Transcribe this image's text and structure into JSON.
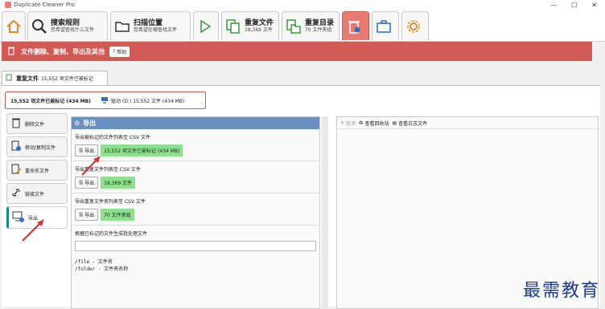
{
  "titlebar": {
    "title": "Duplicate Cleaner Pro",
    "minimize": "—",
    "maximize": "☐",
    "close": "✕"
  },
  "toolbar": {
    "home": "",
    "criteria": {
      "a": "搜索规则",
      "b": "您希望查找什么文件"
    },
    "scan": {
      "a": "扫描位置",
      "b": "您希望在哪查找文件"
    },
    "dupfiles": {
      "a": "重复文件",
      "b": "18,369 文件"
    },
    "dupfolders": {
      "a": "重复目录",
      "b": "70 文件夹组"
    }
  },
  "banner": {
    "title": "文件删除、复制、导出及其他",
    "help": "帮助"
  },
  "subtab": {
    "label": "重复文件",
    "info": "15,552 项文件已被标记"
  },
  "summary": {
    "marked": "15,552 项文件已被标记 (434 MB)",
    "drive": "驱动 (D:) 15,552 文件 (434 MB)"
  },
  "side": {
    "delete": "删除文件",
    "move": "移动/复制文件",
    "rename": "重命名文件",
    "link": "链接文件",
    "export": "导出"
  },
  "mid": {
    "title": "导出",
    "s1": {
      "h": "导出被标记的文件列表至 CSV 文件",
      "btn": "导出",
      "tag": "15,552 项文件已被标记 (434 MB)"
    },
    "s2": {
      "h": "导出重复文件列表至 CSV 文件",
      "btn": "导出",
      "tag": "18,369 文件"
    },
    "s3": {
      "h": "导出重复文件夹列表至 CSV 文件",
      "btn": "导出",
      "tag": "70 文件夹组"
    },
    "s4": {
      "h": "根据已标记的文件生成批处理文件",
      "l1": "/file - 文件名",
      "l2": "/folder - 文件夹名称"
    }
  },
  "right": {
    "cancel": "取消",
    "recycle": "查看回收站",
    "log": "查看日志文件"
  },
  "watermark": "最需教育"
}
